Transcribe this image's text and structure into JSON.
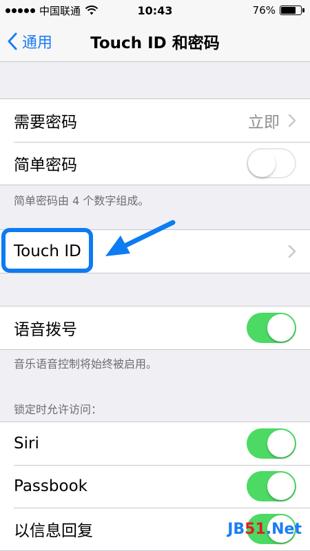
{
  "status_bar": {
    "carrier": "中国联通",
    "time": "10:43",
    "battery_percent": "76%",
    "battery_level": 0.76,
    "signal_icon": "signal-dots-icon",
    "wifi_icon": "wifi-icon",
    "battery_icon": "battery-icon"
  },
  "nav": {
    "back_label": "通用",
    "back_icon": "chevron-left-icon",
    "title": "Touch ID 和密码"
  },
  "passcode_group": {
    "require_passcode": {
      "label": "需要密码",
      "value": "立即"
    },
    "simple_passcode": {
      "label": "简单密码",
      "toggle_on": false
    },
    "footer": "简单密码由 4 个数字组成。"
  },
  "touch_id_group": {
    "touch_id": {
      "label": "Touch ID"
    }
  },
  "voice_dial_group": {
    "voice_dial": {
      "label": "语音拨号",
      "toggle_on": true
    },
    "footer": "音乐语音控制将始终被启用。"
  },
  "locked_access_group": {
    "header": "锁定时允许访问：",
    "siri": {
      "label": "Siri",
      "toggle_on": true
    },
    "passbook": {
      "label": "Passbook",
      "toggle_on": true
    },
    "reply_message": {
      "label": "以信息回复",
      "toggle_on": true
    }
  },
  "watermark": {
    "part1": "JB",
    "part2": "51",
    "part3": ".Net"
  },
  "colors": {
    "accent": "#1a7cf5",
    "toggle_on": "#4cd964",
    "annotation_blue": "#0d7bf2",
    "background": "#efeff4"
  }
}
